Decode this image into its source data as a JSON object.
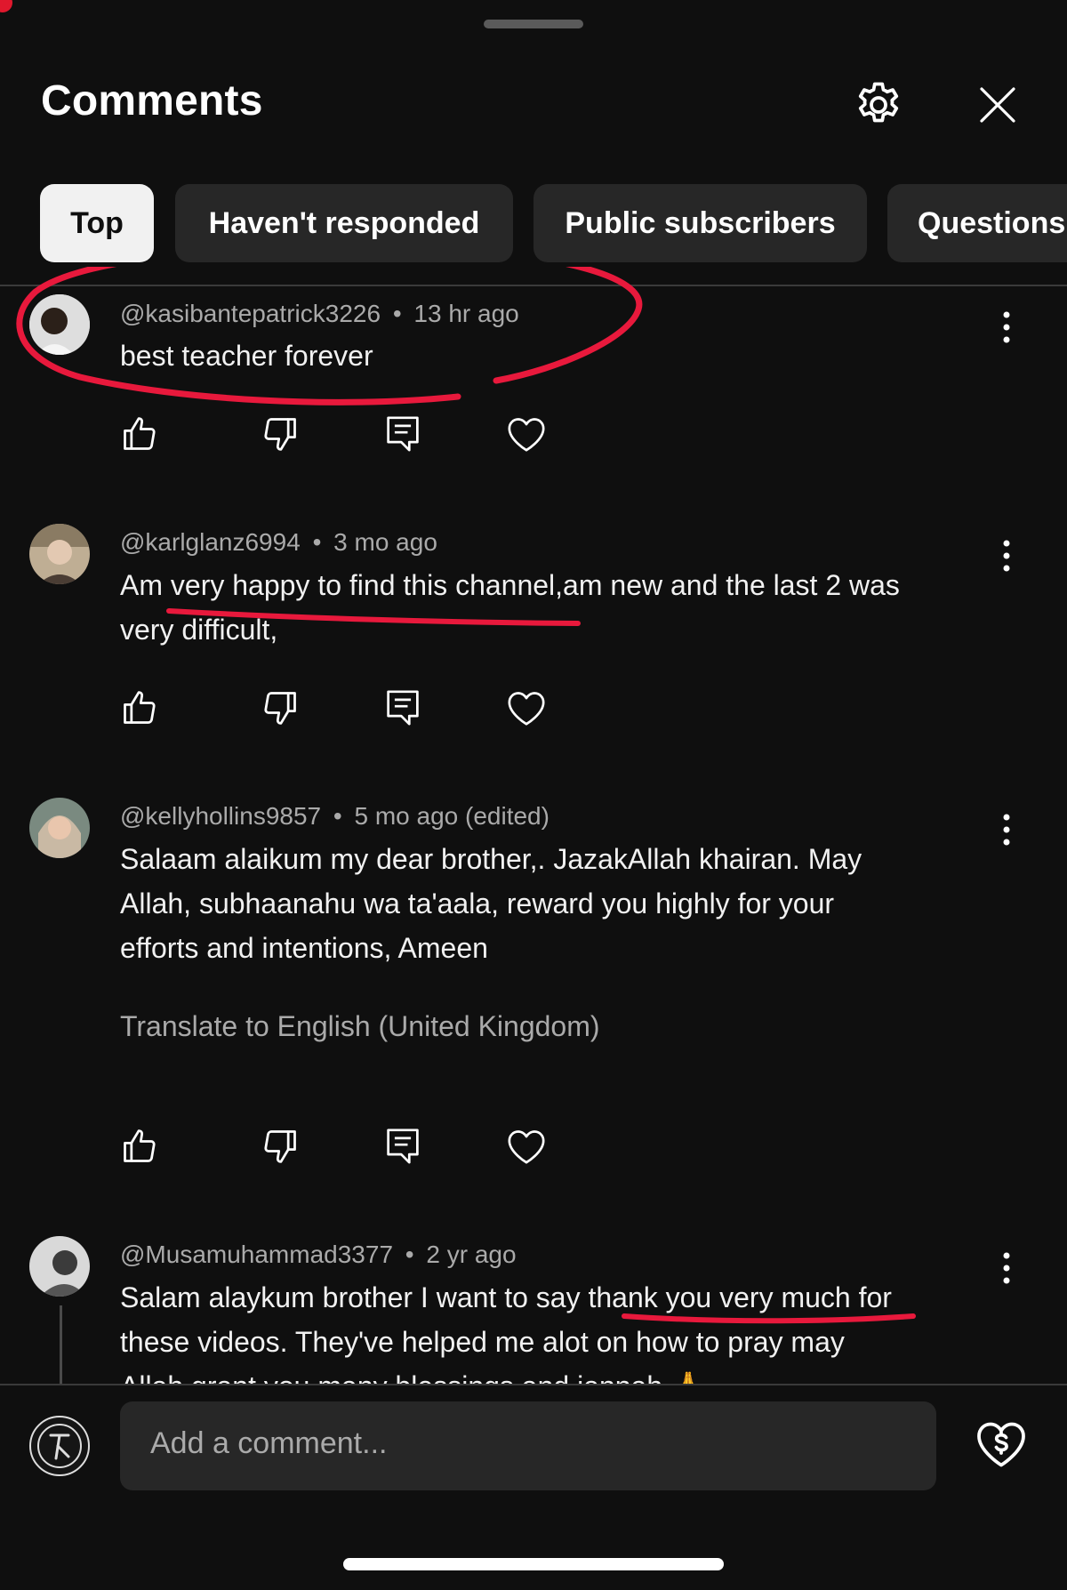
{
  "header": {
    "title": "Comments",
    "settings_icon": "gear-icon",
    "close_icon": "close-icon"
  },
  "filters": [
    {
      "label": "Top",
      "active": true
    },
    {
      "label": "Haven't responded",
      "active": false
    },
    {
      "label": "Public subscribers",
      "active": false
    },
    {
      "label": "Questions",
      "active": false
    }
  ],
  "comments": [
    {
      "author": "@kasibantepatrick3226",
      "separator": "•",
      "time": "13 hr ago",
      "text": [
        "best teacher forever"
      ]
    },
    {
      "author": "@karlglanz6994",
      "separator": "•",
      "time": "3 mo ago",
      "text": [
        "Am very happy to find this channel,am new and the last 2 was",
        "very difficult,"
      ]
    },
    {
      "author": "@kellyhollins9857",
      "separator": "•",
      "time": "5 mo ago (edited)",
      "text": [
        "Salaam alaikum my dear brother,. JazakAllah khairan. May",
        "Allah, subhaanahu wa ta'aala, reward you highly for your",
        "efforts and intentions, Ameen"
      ],
      "translate": "Translate to English (United Kingdom)"
    },
    {
      "author": "@Musamuhammad3377",
      "separator": "•",
      "time": "2 yr ago",
      "text": [
        "Salam alaykum brother I want to say thank you very much for",
        "these videos. They've helped me alot on how to pray may",
        "Allah grant you many blessings and jannah 🙏"
      ]
    }
  ],
  "actions": [
    "thumbs-up-icon",
    "thumbs-down-icon",
    "reply-icon",
    "heart-icon"
  ],
  "composer": {
    "placeholder": "Add a comment...",
    "supers_icon": "heart-dollar-icon"
  },
  "colors": {
    "background": "#0f0f0f",
    "chip": "#272727",
    "chip_active": "#f1f1f1",
    "annotation": "#e8193c"
  }
}
